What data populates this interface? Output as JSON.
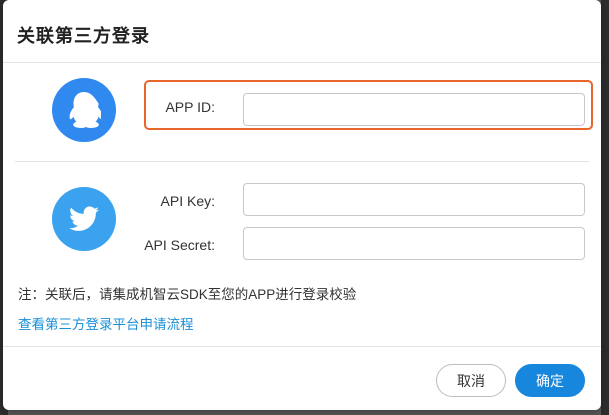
{
  "dialog": {
    "title": "关联第三方登录"
  },
  "qq_section": {
    "icon": "qq-penguin-icon",
    "icon_color": "#2f89ef",
    "highlight_color": "#e9662b",
    "app_id_label": "APP ID:",
    "app_id_value": ""
  },
  "twitter_section": {
    "icon": "twitter-bird-icon",
    "icon_color": "#3aa2ee",
    "api_key_label": "API Key:",
    "api_key_value": "",
    "api_secret_label": "API Secret:",
    "api_secret_value": ""
  },
  "note": "注：关联后，请集成机智云SDK至您的APP进行登录校验",
  "help_link": "查看第三方登录平台申请流程",
  "footer": {
    "cancel_label": "取消",
    "confirm_label": "确定",
    "confirm_color": "#1787dd"
  }
}
